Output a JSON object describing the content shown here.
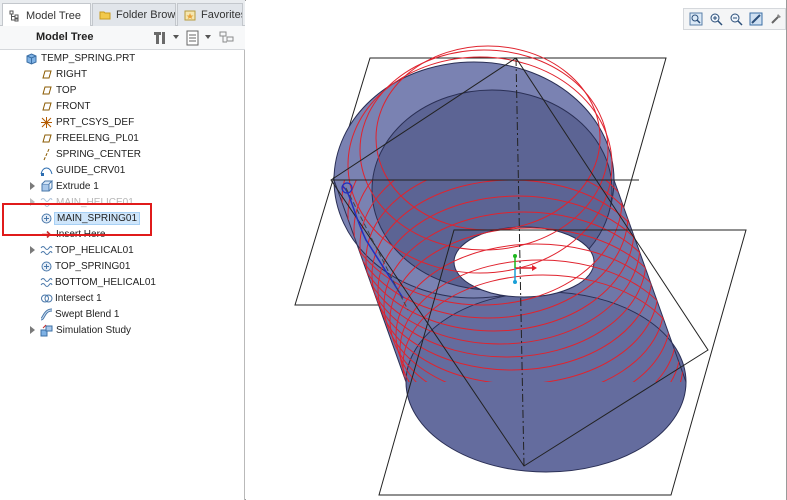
{
  "tabs": [
    {
      "label": "Model Tree",
      "icon": "model-tree-icon",
      "active": true
    },
    {
      "label": "Folder Brow...",
      "icon": "folder-icon",
      "active": false
    },
    {
      "label": "Favorites",
      "icon": "favorites-icon",
      "active": false
    }
  ],
  "header": {
    "title": "Model Tree"
  },
  "tree": {
    "root": "TEMP_SPRING.PRT",
    "items": [
      {
        "label": "RIGHT",
        "icon": "datum-plane-icon"
      },
      {
        "label": "TOP",
        "icon": "datum-plane-icon"
      },
      {
        "label": "FRONT",
        "icon": "datum-plane-icon"
      },
      {
        "label": "PRT_CSYS_DEF",
        "icon": "coordinate-system-icon"
      },
      {
        "label": "FREELENG_PL01",
        "icon": "datum-plane-icon"
      },
      {
        "label": "SPRING_CENTER",
        "icon": "datum-axis-icon"
      },
      {
        "label": "GUIDE_CRV01",
        "icon": "curve-icon"
      },
      {
        "label": "Extrude 1",
        "icon": "extrude-icon"
      },
      {
        "label": "MAIN_HELICE01",
        "icon": "helical-sweep-icon"
      },
      {
        "label": "MAIN_SPRING01",
        "icon": "spring-feature-icon"
      },
      {
        "label": "Insert Here",
        "icon": "insert-arrow-icon"
      },
      {
        "label": "TOP_HELICAL01",
        "icon": "helical-sweep-icon"
      },
      {
        "label": "TOP_SPRING01",
        "icon": "spring-feature-icon"
      },
      {
        "label": "BOTTOM_HELICAL01",
        "icon": "helical-sweep-icon"
      },
      {
        "label": "Intersect 1",
        "icon": "intersect-icon"
      },
      {
        "label": "Swept Blend 1",
        "icon": "swept-blend-icon"
      },
      {
        "label": "Simulation Study",
        "icon": "simulation-icon"
      }
    ]
  },
  "viewport_tools": [
    "refit-icon",
    "zoom-in-icon",
    "zoom-out-icon",
    "repaint-icon",
    "settings-icon"
  ],
  "colors": {
    "cylinder_fill": "#6f77a8",
    "helix": "#e0232e",
    "selection": "#cfe6fb",
    "highlight_box": "#e01b1b"
  }
}
